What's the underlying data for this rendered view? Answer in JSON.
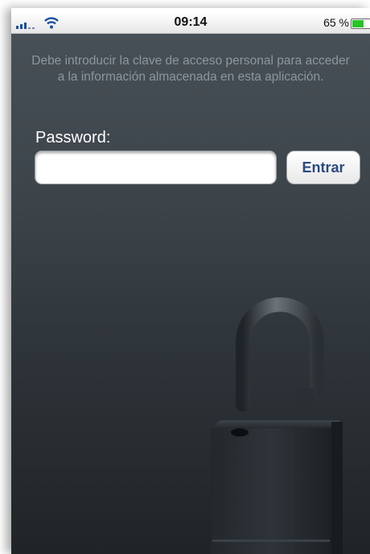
{
  "status_bar": {
    "time": "09:14",
    "battery_percent_label": "65 %",
    "battery_level": 0.65,
    "signal_icon": "signal-bars-icon",
    "wifi_icon": "wifi-icon",
    "battery_icon": "battery-icon"
  },
  "login": {
    "instructions": "Debe introducir la clave de acceso personal para acceder a la información almacenada en esta aplicación.",
    "password_label": "Password:",
    "password_value": "",
    "enter_button_label": "Entrar"
  },
  "background": {
    "illustration_icon": "open-padlock-icon"
  },
  "colors": {
    "background_top": "#485057",
    "background_bottom": "#202427",
    "instructions_text": "#8d969d",
    "button_text": "#2a4b80",
    "battery_fill": "#28c428"
  }
}
